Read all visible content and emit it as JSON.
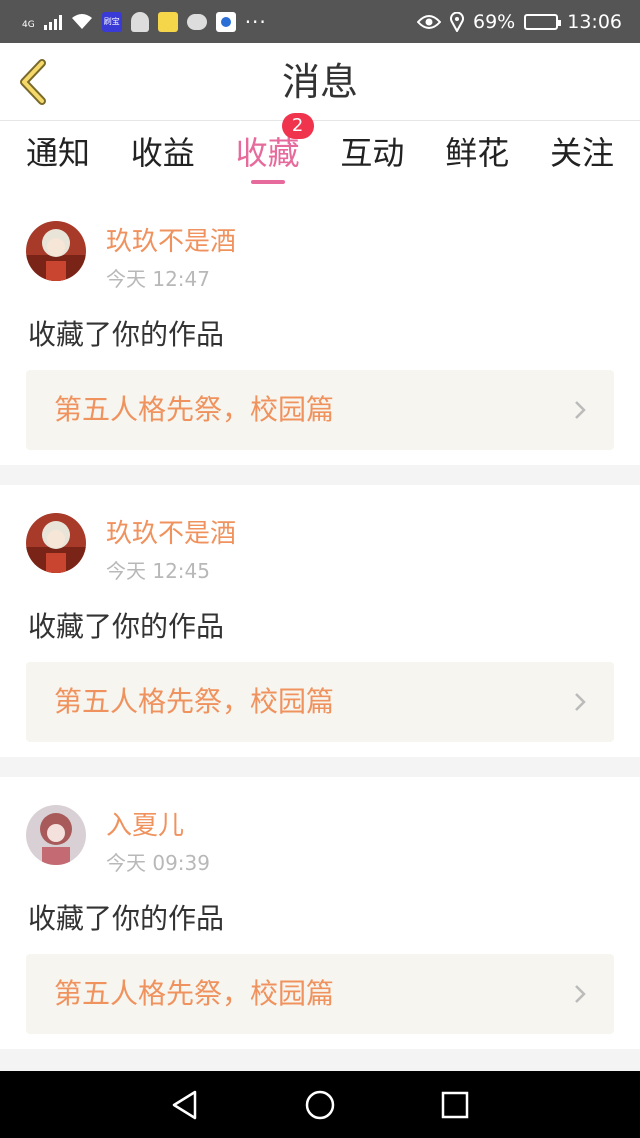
{
  "status_bar": {
    "network": "4G",
    "icons": [
      "wifi-icon",
      "app-badge-icon",
      "qq-icon",
      "mascot-icon",
      "message-icon",
      "app-icon",
      "more-dots-icon"
    ],
    "battery": "69%",
    "battery_level": 0.69,
    "time": "13:06"
  },
  "header": {
    "title": "消息",
    "back_icon": "chevron-left-icon"
  },
  "tabs": [
    {
      "label": "通知",
      "active": false
    },
    {
      "label": "收益",
      "active": false
    },
    {
      "label": "收藏",
      "active": true,
      "badge": "2"
    },
    {
      "label": "互动",
      "active": false
    },
    {
      "label": "鲜花",
      "active": false
    },
    {
      "label": "关注",
      "active": false
    }
  ],
  "notifications": [
    {
      "user": "玖玖不是酒",
      "time": "今天 12:47",
      "action": "收藏了你的作品",
      "work_title": "第五人格先祭，校园篇"
    },
    {
      "user": "玖玖不是酒",
      "time": "今天 12:45",
      "action": "收藏了你的作品",
      "work_title": "第五人格先祭，校园篇"
    },
    {
      "user": "入夏儿",
      "time": "今天 09:39",
      "action": "收藏了你的作品",
      "work_title": "第五人格先祭，校园篇"
    }
  ],
  "colors": {
    "accent": "#e66a9c",
    "username": "#f0925e",
    "badge": "#f0344d",
    "status_bar": "#555555"
  }
}
